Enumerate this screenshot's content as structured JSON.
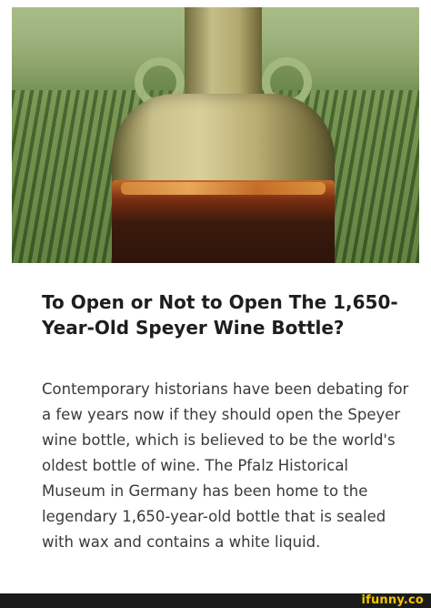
{
  "article": {
    "image_alt_icon": "wine-bottle-photo",
    "headline": "To Open or Not to Open The 1,650-Year-Old Speyer Wine Bottle?",
    "body": "Contemporary historians have been debating for a few years now if they should open the Speyer wine bottle, which is believed to be the world's oldest bottle of wine. The Pfalz Historical Museum in Germany has been home to the legendary 1,650-year-old bottle that is sealed with wax and contains a white liquid."
  },
  "footer": {
    "watermark": "ifunny.co"
  },
  "colors": {
    "footer_bg": "#1b1b1b",
    "watermark": "#f5c400",
    "headline": "#1e1e1e",
    "body": "#3a3a3a"
  }
}
